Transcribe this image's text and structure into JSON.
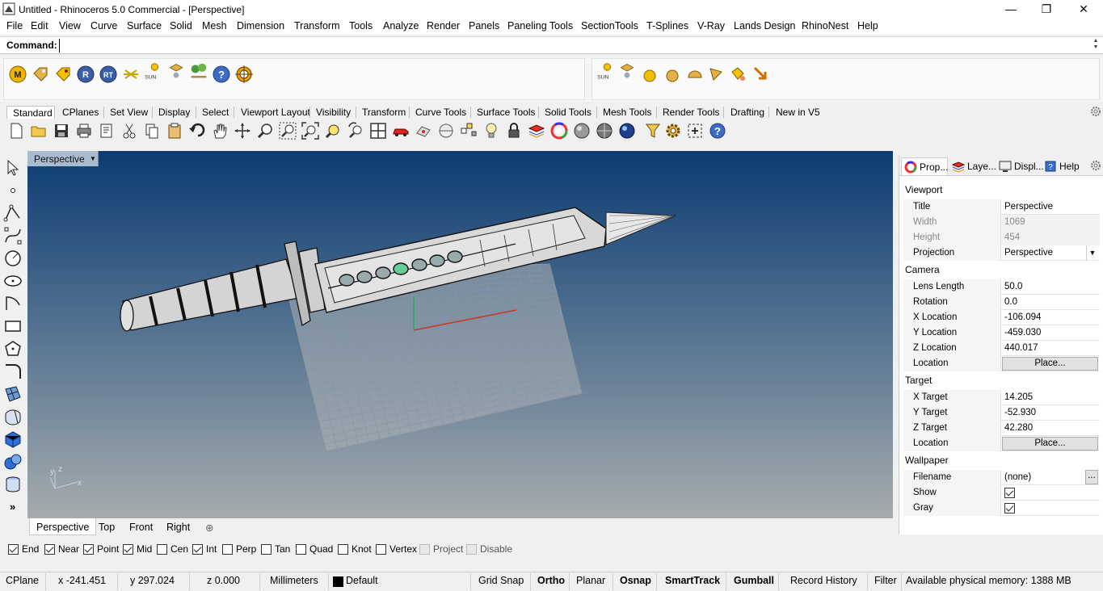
{
  "window": {
    "title": "Untitled - Rhinoceros 5.0 Commercial - [Perspective]",
    "minimize": "—",
    "restore": "❐",
    "close": "✕"
  },
  "menu": [
    "File",
    "Edit",
    "View",
    "Curve",
    "Surface",
    "Solid",
    "Mesh",
    "Dimension",
    "Transform",
    "Tools",
    "Analyze",
    "Render",
    "Panels",
    "Paneling Tools",
    "SectionTools",
    "T-Splines",
    "V-Ray",
    "Lands Design",
    "RhinoNest",
    "Help"
  ],
  "command": {
    "label": "Command:",
    "value": ""
  },
  "plugin_icons_left": [
    "m-plugin-icon",
    "tag-icon",
    "tag-gold-icon",
    "r-plugin-icon",
    "rt-plugin-icon",
    "light-rays-icon",
    "sun-icon",
    "light-icon",
    "trees-icon",
    "help-icon",
    "target-icon"
  ],
  "plugin_sun_label": "SUN",
  "toolbar_tabs": [
    "Standard",
    "CPlanes",
    "Set View",
    "Display",
    "Select",
    "Viewport Layout",
    "Visibility",
    "Transform",
    "Curve Tools",
    "Surface Tools",
    "Solid Tools",
    "Mesh Tools",
    "Render Tools",
    "Drafting",
    "New in V5"
  ],
  "viewport": {
    "title": "Perspective",
    "dropdown": "▼",
    "axes": {
      "x": "x",
      "y": "y",
      "z": "z"
    }
  },
  "viewport_tabs": [
    "Perspective",
    "Top",
    "Front",
    "Right"
  ],
  "viewport_add": "⊕",
  "panel": {
    "tabs": [
      "Prop...",
      "Laye...",
      "Displ...",
      "Help"
    ],
    "sections": {
      "viewport": "Viewport",
      "camera": "Camera",
      "target": "Target",
      "wallpaper": "Wallpaper"
    },
    "viewport_rows": [
      {
        "k": "Title",
        "v": "Perspective"
      },
      {
        "k": "Width",
        "v": "1069"
      },
      {
        "k": "Height",
        "v": "454"
      },
      {
        "k": "Projection",
        "v": "Perspective"
      }
    ],
    "camera_rows": [
      {
        "k": "Lens Length",
        "v": "50.0"
      },
      {
        "k": "Rotation",
        "v": "0.0"
      },
      {
        "k": "X Location",
        "v": "-106.094"
      },
      {
        "k": "Y Location",
        "v": "-459.030"
      },
      {
        "k": "Z Location",
        "v": "440.017"
      },
      {
        "k": "Location",
        "v": "Place..."
      }
    ],
    "target_rows": [
      {
        "k": "X Target",
        "v": "14.205"
      },
      {
        "k": "Y Target",
        "v": "-52.930"
      },
      {
        "k": "Z Target",
        "v": "42.280"
      },
      {
        "k": "Location",
        "v": "Place..."
      }
    ],
    "wallpaper_rows": [
      {
        "k": "Filename",
        "v": "(none)"
      },
      {
        "k": "Show",
        "v": true
      },
      {
        "k": "Gray",
        "v": true
      }
    ],
    "ellipsis": "..."
  },
  "osnaps": [
    {
      "label": "End",
      "on": true
    },
    {
      "label": "Near",
      "on": true
    },
    {
      "label": "Point",
      "on": true
    },
    {
      "label": "Mid",
      "on": true
    },
    {
      "label": "Cen",
      "on": false
    },
    {
      "label": "Int",
      "on": true
    },
    {
      "label": "Perp",
      "on": false
    },
    {
      "label": "Tan",
      "on": false
    },
    {
      "label": "Quad",
      "on": false
    },
    {
      "label": "Knot",
      "on": false
    },
    {
      "label": "Vertex",
      "on": false
    },
    {
      "label": "Project",
      "on": false
    },
    {
      "label": "Disable",
      "on": false
    }
  ],
  "status": {
    "cplane": "CPlane",
    "x": "x -241.451",
    "y": "y 297.024",
    "z": "z 0.000",
    "units": "Millimeters",
    "layer": "Default",
    "grid_snap": "Grid Snap",
    "ortho": "Ortho",
    "planar": "Planar",
    "osnap": "Osnap",
    "smarttrack": "SmartTrack",
    "gumball": "Gumball",
    "record_history": "Record History",
    "filter": "Filter",
    "memory": "Available physical memory: 1388 MB"
  },
  "left_more": "»",
  "colors": {
    "viewport_top": "#0c3c73",
    "viewport_bottom": "#a6acae",
    "grid": "#9aa3ab",
    "x_axis": "#c0392b",
    "y_axis": "#27ae60"
  }
}
